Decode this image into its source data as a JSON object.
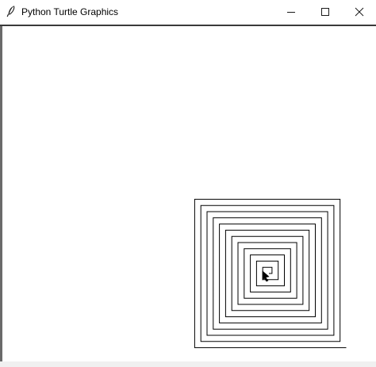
{
  "window": {
    "title": "Python Turtle Graphics",
    "icon": "feather-icon",
    "controls": {
      "minimize_icon": "minimize-icon",
      "maximize_icon": "maximize-icon",
      "close_icon": "close-icon"
    }
  },
  "canvas": {
    "background": "#ffffff",
    "pen_color": "#000000",
    "drawing": "square-spiral",
    "cursor_icon": "turtle-arrow-icon"
  }
}
